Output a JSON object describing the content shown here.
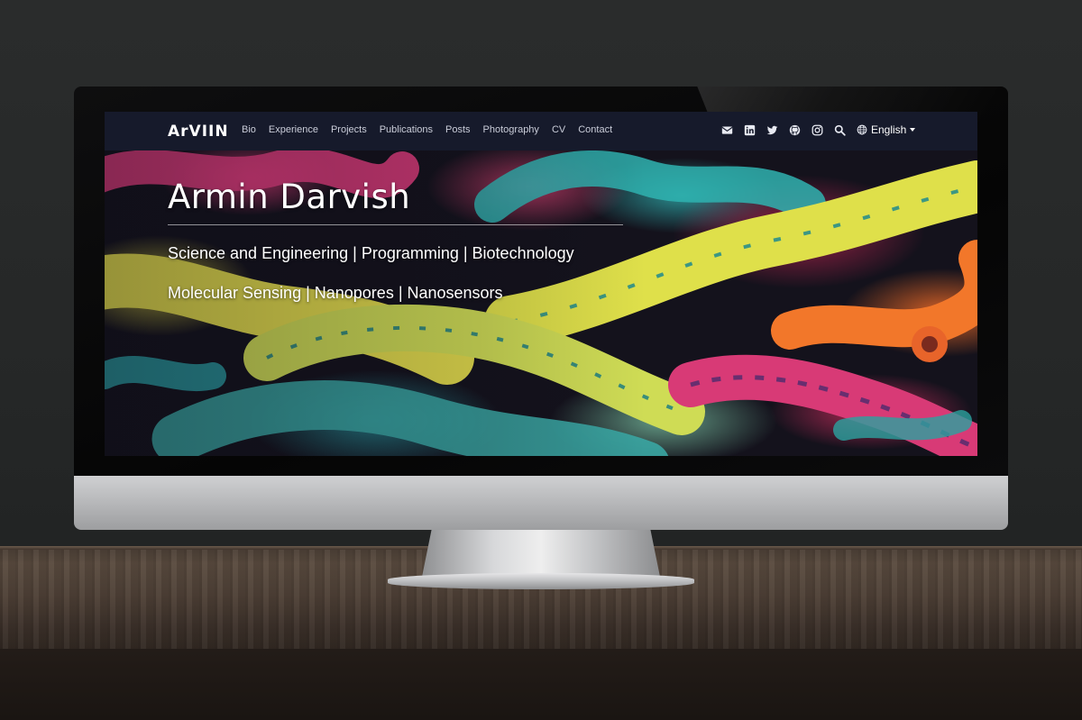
{
  "navbar": {
    "brand": "ArVIIN",
    "links": [
      "Bio",
      "Experience",
      "Projects",
      "Publications",
      "Posts",
      "Photography",
      "CV",
      "Contact"
    ],
    "icons": [
      "envelope-icon",
      "linkedin-icon",
      "twitter-icon",
      "github-icon",
      "instagram-icon",
      "search-icon"
    ],
    "language": "English"
  },
  "hero": {
    "title": "Armin Darvish",
    "line1": "Science and Engineering | Programming | Biotechnology",
    "line2": "Molecular Sensing | Nanopores | Nanosensors"
  },
  "colors": {
    "navbar_bg": "#161a2b",
    "nav_link": "#c9ccd8",
    "accent_yellow": "#e4df52",
    "accent_teal": "#2b9aa0",
    "accent_pink": "#e23d7e",
    "accent_orange": "#f2772a"
  }
}
